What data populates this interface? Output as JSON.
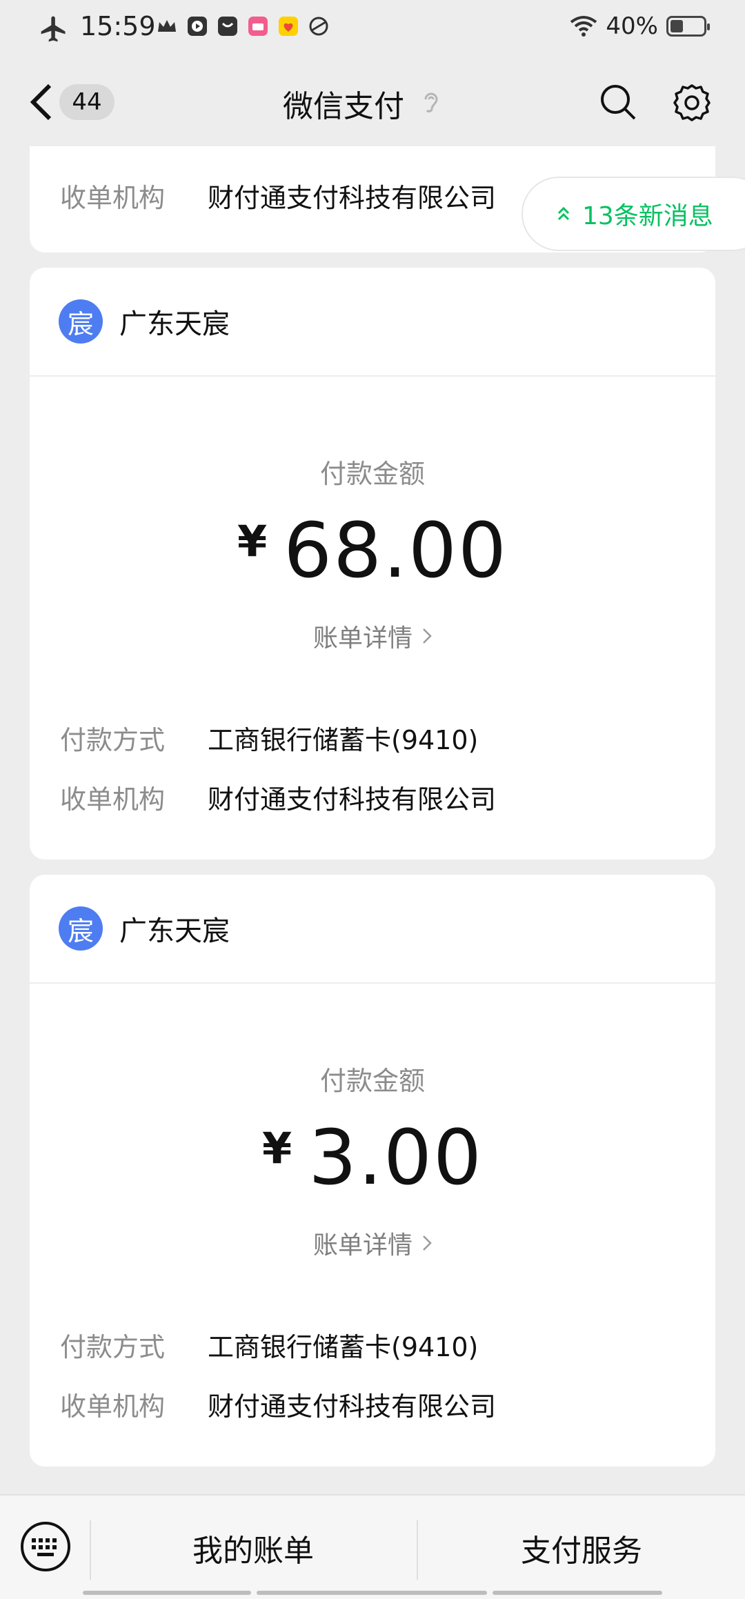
{
  "status_bar": {
    "time": "15:59",
    "battery": "40%",
    "battery_level": 0.4
  },
  "header": {
    "back_count": "44",
    "title": "微信支付"
  },
  "new_messages": "13条新消息",
  "top_card": {
    "acquirer_label": "收单机构",
    "acquirer_value": "财付通支付科技有限公司"
  },
  "cards": [
    {
      "merchant_avatar": "宸",
      "merchant_name": "广东天宸",
      "amount_label": "付款金额",
      "currency": "¥",
      "amount": "68.00",
      "bill_detail": "账单详情",
      "payment_method_label": "付款方式",
      "payment_method": "工商银行储蓄卡(9410)",
      "acquirer_label": "收单机构",
      "acquirer_value": "财付通支付科技有限公司"
    },
    {
      "merchant_avatar": "宸",
      "merchant_name": "广东天宸",
      "amount_label": "付款金额",
      "currency": "¥",
      "amount": "3.00",
      "bill_detail": "账单详情",
      "payment_method_label": "付款方式",
      "payment_method": "工商银行储蓄卡(9410)",
      "acquirer_label": "收单机构",
      "acquirer_value": "财付通支付科技有限公司"
    }
  ],
  "bottom_menu": {
    "my_bills": "我的账单",
    "pay_services": "支付服务"
  },
  "colors": {
    "accent_green": "#07c160",
    "merchant_blue": "#4e7df1",
    "background": "#ededed"
  }
}
